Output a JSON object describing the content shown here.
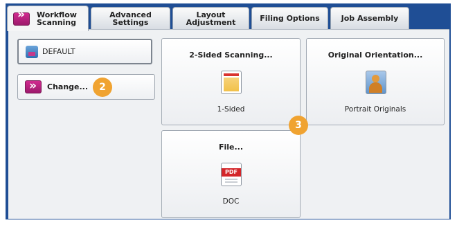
{
  "tabs": [
    {
      "label": "Workflow\nScanning"
    },
    {
      "label": "Advanced\nSettings"
    },
    {
      "label": "Layout\nAdjustment"
    },
    {
      "label": "Filing Options"
    },
    {
      "label": "Job Assembly"
    }
  ],
  "sidebar": {
    "preset_label": "DEFAULT",
    "change_label": "Change..."
  },
  "two_sided": {
    "title": "2-Sided Scanning...",
    "value": "1-Sided"
  },
  "orientation": {
    "title": "Original Orientation...",
    "value": "Portrait Originals"
  },
  "file": {
    "title": "File...",
    "value": "DOC",
    "icon_text": "PDF"
  },
  "callouts": {
    "first": "2",
    "second": "3"
  }
}
